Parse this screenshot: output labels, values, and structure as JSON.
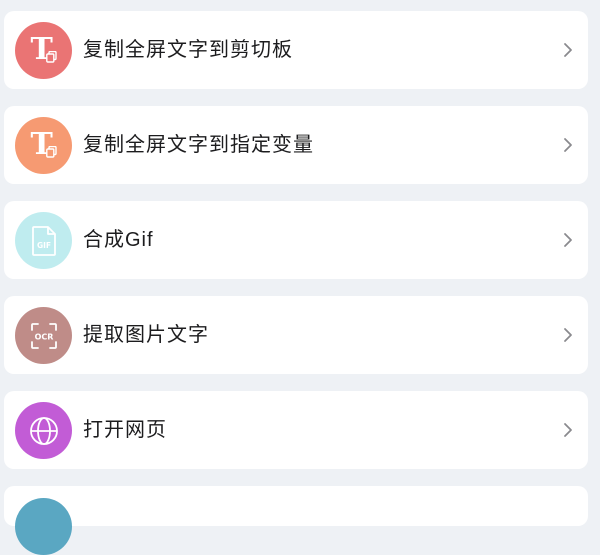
{
  "items": [
    {
      "label": "复制全屏文字到剪切板",
      "icon": "text-copy-icon",
      "color": "#ea7474"
    },
    {
      "label": "复制全屏文字到指定变量",
      "icon": "text-copy-icon",
      "color": "#f69a72"
    },
    {
      "label": "合成Gif",
      "icon": "gif-file-icon",
      "color": "#bfecef"
    },
    {
      "label": "提取图片文字",
      "icon": "ocr-scan-icon",
      "color": "#bf8c88"
    },
    {
      "label": "打开网页",
      "icon": "globe-icon",
      "color": "#c25cd6"
    },
    {
      "label": "",
      "icon": "",
      "color": "#5aa7c2"
    }
  ],
  "icon_text": {
    "gif": "GIF",
    "ocr": "OCR"
  }
}
